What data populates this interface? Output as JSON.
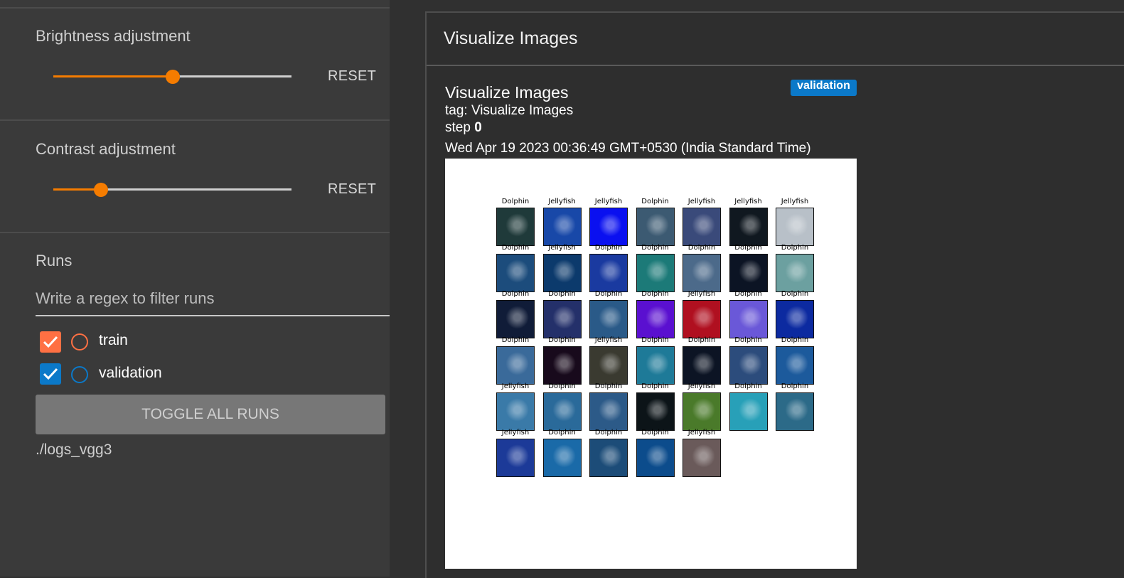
{
  "sidebar": {
    "brightness": {
      "title": "Brightness adjustment",
      "reset_label": "RESET",
      "value": 0.5
    },
    "contrast": {
      "title": "Contrast adjustment",
      "reset_label": "RESET",
      "value": 0.2
    },
    "runs": {
      "title": "Runs",
      "filter_placeholder": "Write a regex to filter runs",
      "items": [
        {
          "label": "train",
          "checked": true,
          "color": "#ff7043"
        },
        {
          "label": "validation",
          "checked": true,
          "color": "#0b79c9"
        }
      ],
      "toggle_all_label": "TOGGLE ALL RUNS",
      "logdir": "./logs_vgg3"
    }
  },
  "card": {
    "header_title": "Visualize Images",
    "title": "Visualize Images",
    "tag_line": "tag: Visualize Images",
    "step_prefix": "step",
    "step_value": "0",
    "timestamp": "Wed Apr 19 2023 00:36:49 GMT+0530 (India Standard Time)",
    "run_badge": "validation",
    "grid": [
      [
        "Dolphin",
        "Jellyfish",
        "Jellyfish",
        "Dolphin",
        "Jellyfish",
        "Jellyfish",
        "Jellyfish"
      ],
      [
        "Dolphin",
        "Jellyfish",
        "Dolphin",
        "Dolphin",
        "Dolphin",
        "Dolphin",
        "Dolphin"
      ],
      [
        "Dolphin",
        "Dolphin",
        "Dolphin",
        "Dolphin",
        "Jellyfish",
        "Dolphin",
        "Dolphin"
      ],
      [
        "Dolphin",
        "Dolphin",
        "Jellyfish",
        "Dolphin",
        "Dolphin",
        "Dolphin",
        "Dolphin"
      ],
      [
        "Jellyfish",
        "Dolphin",
        "Dolphin",
        "Dolphin",
        "Jellyfish",
        "Dolphin",
        "Dolphin"
      ],
      [
        "Jellyfish",
        "Dolphin",
        "Dolphin",
        "Dolphin",
        "Jellyfish"
      ]
    ],
    "thumb_colors": [
      [
        "#1f3a3a",
        "#1848a8",
        "#0a10f0",
        "#3c5a72",
        "#3a4a7a",
        "#101820",
        "#b8c0c8"
      ],
      [
        "#1c4c7c",
        "#0c3a6c",
        "#1a3aa0",
        "#1c7a78",
        "#4c6a8a",
        "#0c1424",
        "#6ca0a0"
      ],
      [
        "#101c38",
        "#24306a",
        "#2a5a88",
        "#5a10d0",
        "#b01020",
        "#6a58d8",
        "#0c2aa0"
      ],
      [
        "#3a6a9a",
        "#180a1c",
        "#3a3a30",
        "#1e7a98",
        "#0c1424",
        "#2c4c7c",
        "#1c5a9c"
      ],
      [
        "#3a7aa8",
        "#2a6a9a",
        "#2c5a88",
        "#0c1418",
        "#4a7a2a",
        "#28a0b8",
        "#2c6a88"
      ],
      [
        "#1c3a98",
        "#1a6aa8",
        "#1c4c78",
        "#0c4c8c",
        "#6a5a5a"
      ]
    ]
  }
}
